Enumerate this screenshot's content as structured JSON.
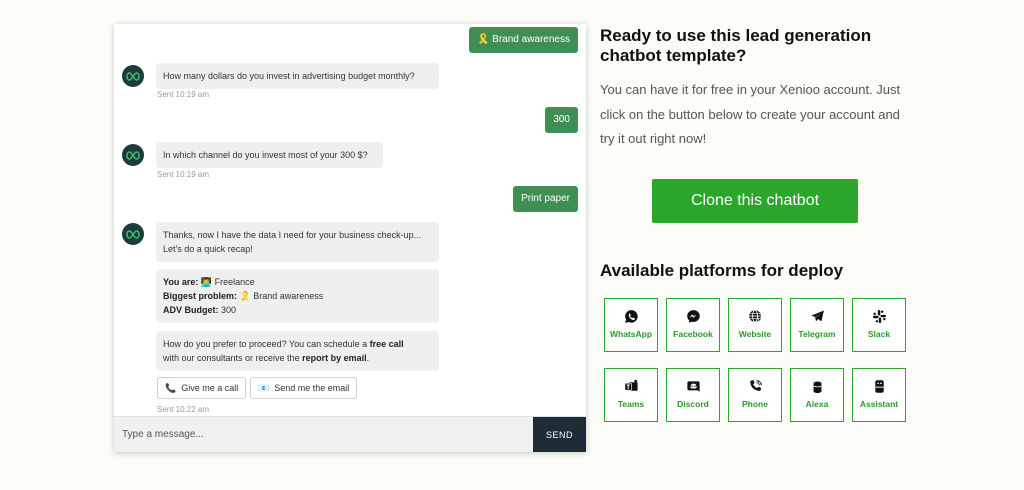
{
  "chat": {
    "messages": {
      "user1": "Brand awareness",
      "bot1": "How many dollars do you invest in advertising budget monthly?",
      "sent1": "Sent 10:19 am",
      "user2": "300",
      "bot2": "In which channel do you invest most of your 300 $?",
      "sent2": "Sent 10:19 am",
      "user3": "Print paper",
      "bot3_line1": "Thanks, now I have the data I need for your business check-up...",
      "bot3_line2": "Let's do a quick recap!",
      "recap": {
        "you_are_label": "You are:",
        "you_are_value": "Freelance",
        "problem_label": "Biggest problem:",
        "problem_value": "Brand awareness",
        "budget_label": "ADV Budget:",
        "budget_value": "300"
      },
      "proceed": {
        "t1": "How do you prefer to proceed? You can schedule a ",
        "b1": "free call",
        "t2": "with our consultants or receive the ",
        "b2": "report by email",
        "t3": "."
      },
      "sent3": "Sent 10:22 am"
    },
    "quick_replies": {
      "call": "Give me a call",
      "email": "Send me the email"
    },
    "input_placeholder": "Type a message...",
    "send_label": "SEND"
  },
  "promo": {
    "heading_line1": "Ready to use this lead generation",
    "heading_line2": "chatbot template?",
    "desc": "You can have it for free in your Xenioo account. Just click on the button below to create your account and try it out right now!",
    "clone_label": "Clone this chatbot",
    "platforms_heading": "Available platforms for deploy"
  },
  "platforms": [
    {
      "label": "WhatsApp",
      "icon": "whatsapp-icon"
    },
    {
      "label": "Facebook",
      "icon": "messenger-icon"
    },
    {
      "label": "Website",
      "icon": "globe-icon"
    },
    {
      "label": "Telegram",
      "icon": "telegram-icon"
    },
    {
      "label": "Slack",
      "icon": "slack-icon"
    },
    {
      "label": "Teams",
      "icon": "teams-icon"
    },
    {
      "label": "Discord",
      "icon": "discord-icon"
    },
    {
      "label": "Phone",
      "icon": "phone-icon"
    },
    {
      "label": "Alexa",
      "icon": "alexa-icon"
    },
    {
      "label": "Assistant",
      "icon": "assistant-icon"
    }
  ],
  "colors": {
    "accent": "#2aa62a",
    "user_bubble": "#3f8f55",
    "send_button": "#1e2c36",
    "bot_avatar": "#1d3b3b"
  }
}
